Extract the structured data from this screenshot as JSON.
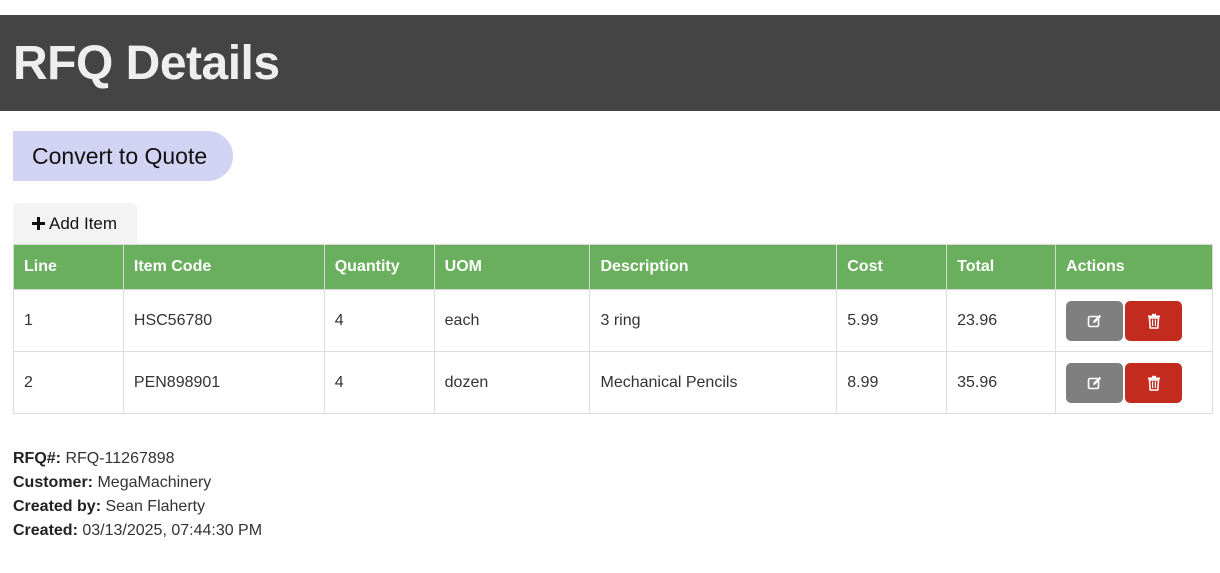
{
  "header": {
    "title": "RFQ Details"
  },
  "actions": {
    "convert_label": "Convert to Quote",
    "add_item_label": "Add Item"
  },
  "table": {
    "columns": [
      "Line",
      "Item Code",
      "Quantity",
      "UOM",
      "Description",
      "Cost",
      "Total",
      "Actions"
    ],
    "rows": [
      {
        "line": "1",
        "item_code": "HSC56780",
        "quantity": "4",
        "uom": "each",
        "description": "3 ring",
        "cost": "5.99",
        "total": "23.96"
      },
      {
        "line": "2",
        "item_code": "PEN898901",
        "quantity": "4",
        "uom": "dozen",
        "description": "Mechanical Pencils",
        "cost": "8.99",
        "total": "35.96"
      }
    ]
  },
  "details": {
    "rfq_label": "RFQ#:",
    "rfq_value": "RFQ-11267898",
    "customer_label": "Customer:",
    "customer_value": "MegaMachinery",
    "created_by_label": "Created by:",
    "created_by_value": "Sean Flaherty",
    "created_label": "Created:",
    "created_value": "03/13/2025, 07:44:30 PM"
  },
  "icons": {
    "add": "plus-icon",
    "edit": "edit-icon",
    "delete": "trash-icon"
  },
  "colors": {
    "header_bg": "#444444",
    "table_header_bg": "#6aaf5e",
    "convert_bg": "#d2d2f2",
    "edit_bg": "#7f7f7f",
    "delete_bg": "#c42b1f"
  }
}
